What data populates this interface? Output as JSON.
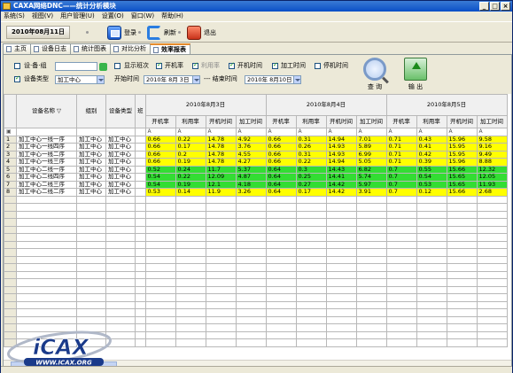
{
  "window": {
    "title": "CAXA网络DNC——统计分析模块"
  },
  "menu": [
    "系统(S)",
    "视图(V)",
    "用户管理(U)",
    "设置(O)",
    "窗口(W)",
    "帮助(H)"
  ],
  "toolbar": {
    "date": "2010年08月11日",
    "login": "登录",
    "refresh": "刷新",
    "exit": "退出"
  },
  "tabs": [
    "主页",
    "设备日志",
    "统计图表",
    "对比分析",
    "效率报表"
  ],
  "active_tab": 4,
  "filter": {
    "device_group_label": "设·备·组",
    "device_group_value": "",
    "show_shift_label": "显示班次",
    "open_rate_label": "开机率",
    "util_rate_label": "利用率",
    "open_time_label": "开机时间",
    "process_time_label": "加工时间",
    "stop_time_label": "停机时间",
    "device_type_label": "设备类型",
    "device_type_value": "加工中心",
    "start_label": "开始时间",
    "start_value": "2010年 8月 3日",
    "end_label": "--- 结束时间",
    "end_value": "2010年 8月10日",
    "query_label": "查 询",
    "export_label": "输 出"
  },
  "grid": {
    "fixed_headers": [
      "设备名称",
      "组别",
      "设备类型",
      "班"
    ],
    "dates": [
      "2010年8月3日",
      "2010年8月4日",
      "2010年8月5日"
    ],
    "sub_headers": [
      "开机率",
      "利用率",
      "开机时间",
      "加工时间"
    ],
    "rows": [
      {
        "no": "1",
        "name": "加工中心一线一序",
        "group": "加工中心",
        "type": "加工中心",
        "color": "yellow",
        "vals": [
          "0.66",
          "0.22",
          "14.78",
          "4.92",
          "0.66",
          "0.31",
          "14.94",
          "7.01",
          "0.71",
          "0.43",
          "15.96",
          "9.58"
        ]
      },
      {
        "no": "2",
        "name": "加工中心一线四序",
        "group": "加工中心",
        "type": "加工中心",
        "color": "yellow",
        "vals": [
          "0.66",
          "0.17",
          "14.78",
          "3.76",
          "0.66",
          "0.26",
          "14.93",
          "5.89",
          "0.71",
          "0.41",
          "15.95",
          "9.16"
        ]
      },
      {
        "no": "3",
        "name": "加工中心一线二序",
        "group": "加工中心",
        "type": "加工中心",
        "color": "yellow",
        "vals": [
          "0.66",
          "0.2",
          "14.78",
          "4.55",
          "0.66",
          "0.31",
          "14.93",
          "6.99",
          "0.71",
          "0.42",
          "15.95",
          "9.49"
        ]
      },
      {
        "no": "4",
        "name": "加工中心一线三序",
        "group": "加工中心",
        "type": "加工中心",
        "color": "yellow",
        "vals": [
          "0.66",
          "0.19",
          "14.78",
          "4.27",
          "0.66",
          "0.22",
          "14.94",
          "5.05",
          "0.71",
          "0.39",
          "15.96",
          "8.88"
        ]
      },
      {
        "no": "5",
        "name": "加工中心二线一序",
        "group": "加工中心",
        "type": "加工中心",
        "color": "green",
        "vals": [
          "0.52",
          "0.24",
          "11.7",
          "5.37",
          "0.64",
          "0.3",
          "14.43",
          "6.82",
          "0.7",
          "0.55",
          "15.66",
          "12.32"
        ]
      },
      {
        "no": "6",
        "name": "加工中心二线四序",
        "group": "加工中心",
        "type": "加工中心",
        "color": "green",
        "vals": [
          "0.54",
          "0.22",
          "12.09",
          "4.87",
          "0.64",
          "0.25",
          "14.41",
          "5.74",
          "0.7",
          "0.54",
          "15.65",
          "12.05"
        ]
      },
      {
        "no": "7",
        "name": "加工中心二线三序",
        "group": "加工中心",
        "type": "加工中心",
        "color": "green",
        "vals": [
          "0.54",
          "0.19",
          "12.1",
          "4.18",
          "0.64",
          "0.27",
          "14.42",
          "5.97",
          "0.7",
          "0.53",
          "15.65",
          "11.93"
        ]
      },
      {
        "no": "8",
        "name": "加工中心二线二序",
        "group": "加工中心",
        "type": "加工中心",
        "color": "yellow",
        "vals": [
          "0.53",
          "0.14",
          "11.9",
          "3.26",
          "0.64",
          "0.17",
          "14.42",
          "3.91",
          "0.7",
          "0.12",
          "15.66",
          "2.68"
        ]
      }
    ]
  },
  "logo": {
    "text": "iCAX",
    "url": "WWW.ICAX.ORG"
  },
  "colors": {
    "yellow": "#ffff00",
    "green": "#33dd33",
    "title_bar": "#0a4fc7"
  }
}
